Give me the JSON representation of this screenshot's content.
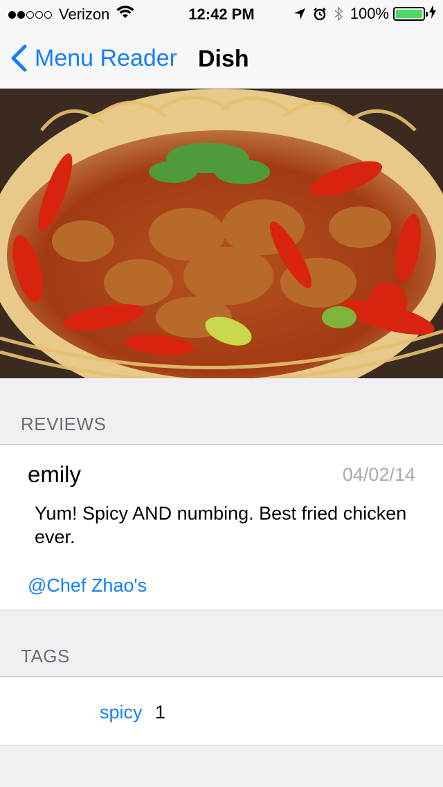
{
  "status_bar": {
    "carrier": "Verizon",
    "time": "12:42 PM",
    "battery": "100%",
    "battery_color": "#4cd964"
  },
  "nav": {
    "back_label": "Menu Reader",
    "title": "Dish"
  },
  "dish": {
    "image": "fried-chicken-with-chilies-photo"
  },
  "reviews": {
    "header": "REVIEWS",
    "items": [
      {
        "user": "emily",
        "date": "04/02/14",
        "text": "Yum! Spicy AND numbing. Best fried chicken ever.",
        "place": "@Chef Zhao's"
      }
    ]
  },
  "tags": {
    "header": "TAGS",
    "items": [
      {
        "name": "spicy",
        "count": "1"
      }
    ]
  },
  "colors": {
    "accent": "#157efb",
    "background": "#efeff4",
    "secondary_text": "#6d6d72"
  }
}
